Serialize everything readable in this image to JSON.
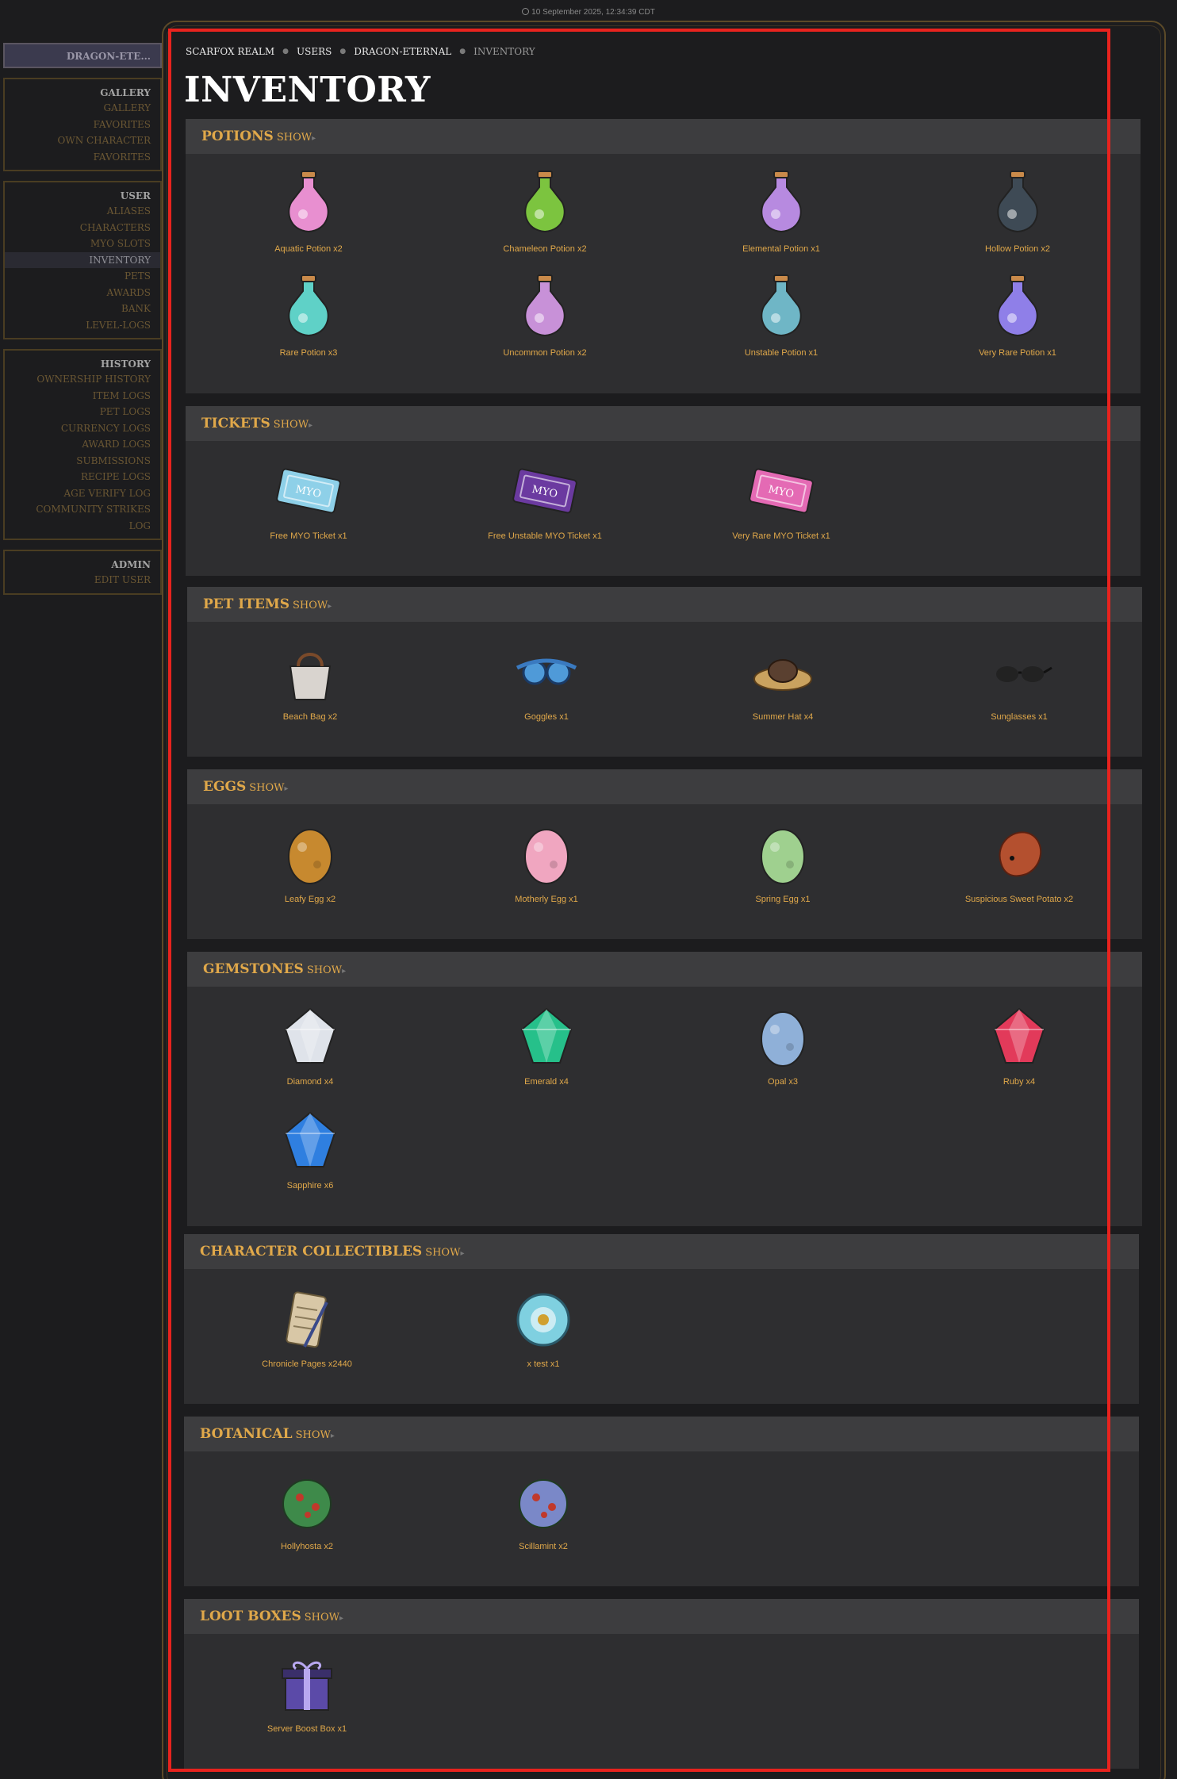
{
  "timestamp": "10 September 2025, 12:34:39 CDT",
  "sidebar": {
    "user_button": "DRAGON-ETE...",
    "groups": [
      {
        "heading": "GALLERY",
        "items": [
          "GALLERY",
          "FAVORITES",
          "OWN CHARACTER FAVORITES"
        ]
      },
      {
        "heading": "USER",
        "items": [
          "ALIASES",
          "CHARACTERS",
          "MYO SLOTS",
          "INVENTORY",
          "PETS",
          "AWARDS",
          "BANK",
          "LEVEL-LOGS"
        ]
      },
      {
        "heading": "HISTORY",
        "items": [
          "OWNERSHIP HISTORY",
          "ITEM LOGS",
          "PET LOGS",
          "CURRENCY LOGS",
          "AWARD LOGS",
          "SUBMISSIONS",
          "RECIPE LOGS",
          "AGE VERIFY LOG",
          "COMMUNITY STRIKES LOG"
        ]
      },
      {
        "heading": "ADMIN",
        "items": [
          "EDIT USER"
        ]
      }
    ]
  },
  "breadcrumb": [
    "SCARFOX REALM",
    "USERS",
    "DRAGON-ETERNAL",
    "INVENTORY"
  ],
  "page_title": "INVENTORY",
  "toggle_label": "SHOW",
  "categories": [
    {
      "title": "POTIONS",
      "items": [
        {
          "label": "Aquatic Potion x2",
          "icon": "aquatic-potion-icon",
          "color": "#e88fd0"
        },
        {
          "label": "Chameleon Potion x2",
          "icon": "chameleon-potion-icon",
          "color": "#7cc43f"
        },
        {
          "label": "Elemental Potion x1",
          "icon": "elemental-potion-icon",
          "color": "#b78ae0"
        },
        {
          "label": "Hollow Potion x2",
          "icon": "hollow-potion-icon",
          "color": "#3e4a55"
        },
        {
          "label": "Rare Potion x3",
          "icon": "rare-potion-icon",
          "color": "#5fd1c7"
        },
        {
          "label": "Uncommon Potion x2",
          "icon": "uncommon-potion-icon",
          "color": "#c891d8"
        },
        {
          "label": "Unstable Potion x1",
          "icon": "unstable-potion-icon",
          "color": "#6fb6c6"
        },
        {
          "label": "Very Rare Potion x1",
          "icon": "very-rare-potion-icon",
          "color": "#8f7fe8"
        }
      ]
    },
    {
      "title": "TICKETS",
      "items": [
        {
          "label": "Free MYO Ticket x1",
          "icon": "free-myo-ticket-icon",
          "color": "#8ed0e8"
        },
        {
          "label": "Free Unstable MYO Ticket x1",
          "icon": "free-unstable-myo-ticket-icon",
          "color": "#6b3aa0"
        },
        {
          "label": "Very Rare MYO Ticket x1",
          "icon": "very-rare-myo-ticket-icon",
          "color": "#e46ab4"
        }
      ]
    },
    {
      "title": "PET ITEMS",
      "items": [
        {
          "label": "Beach Bag x2",
          "icon": "beach-bag-icon",
          "color": "#d9d4cf"
        },
        {
          "label": "Goggles x1",
          "icon": "goggles-icon",
          "color": "#4f9ad8"
        },
        {
          "label": "Summer Hat x4",
          "icon": "summer-hat-icon",
          "color": "#c9a25f"
        },
        {
          "label": "Sunglasses x1",
          "icon": "sunglasses-icon",
          "color": "#222222"
        }
      ]
    },
    {
      "title": "EGGS",
      "items": [
        {
          "label": "Leafy Egg x2",
          "icon": "leafy-egg-icon",
          "color": "#c7892f"
        },
        {
          "label": "Motherly Egg x1",
          "icon": "motherly-egg-icon",
          "color": "#f0a6c0"
        },
        {
          "label": "Spring Egg x1",
          "icon": "spring-egg-icon",
          "color": "#9fd08f"
        },
        {
          "label": "Suspicious Sweet Potato x2",
          "icon": "sweet-potato-icon",
          "color": "#b4502f"
        }
      ]
    },
    {
      "title": "GEMSTONES",
      "items": [
        {
          "label": "Diamond x4",
          "icon": "diamond-icon",
          "color": "#dfe3ea"
        },
        {
          "label": "Emerald x4",
          "icon": "emerald-icon",
          "color": "#26c08a"
        },
        {
          "label": "Opal x3",
          "icon": "opal-icon",
          "color": "#8fb0d8"
        },
        {
          "label": "Ruby x4",
          "icon": "ruby-icon",
          "color": "#e23a5a"
        },
        {
          "label": "Sapphire x6",
          "icon": "sapphire-icon",
          "color": "#2f7fe0"
        }
      ]
    },
    {
      "title": "CHARACTER COLLECTIBLES",
      "items": [
        {
          "label": "Chronicle Pages x2440",
          "icon": "chronicle-pages-icon",
          "color": "#d8c7a6"
        },
        {
          "label": "x test x1",
          "icon": "test-emblem-icon",
          "color": "#7fd0e0"
        }
      ]
    },
    {
      "title": "BOTANICAL",
      "items": [
        {
          "label": "Hollyhosta x2",
          "icon": "hollyhosta-icon",
          "color": "#3e8a4a"
        },
        {
          "label": "Scillamint x2",
          "icon": "scillamint-icon",
          "color": "#7a88c8"
        }
      ]
    },
    {
      "title": "LOOT BOXES",
      "items": [
        {
          "label": "Server Boost Box x1",
          "icon": "server-boost-box-icon",
          "color": "#5b4aa8"
        }
      ]
    }
  ]
}
